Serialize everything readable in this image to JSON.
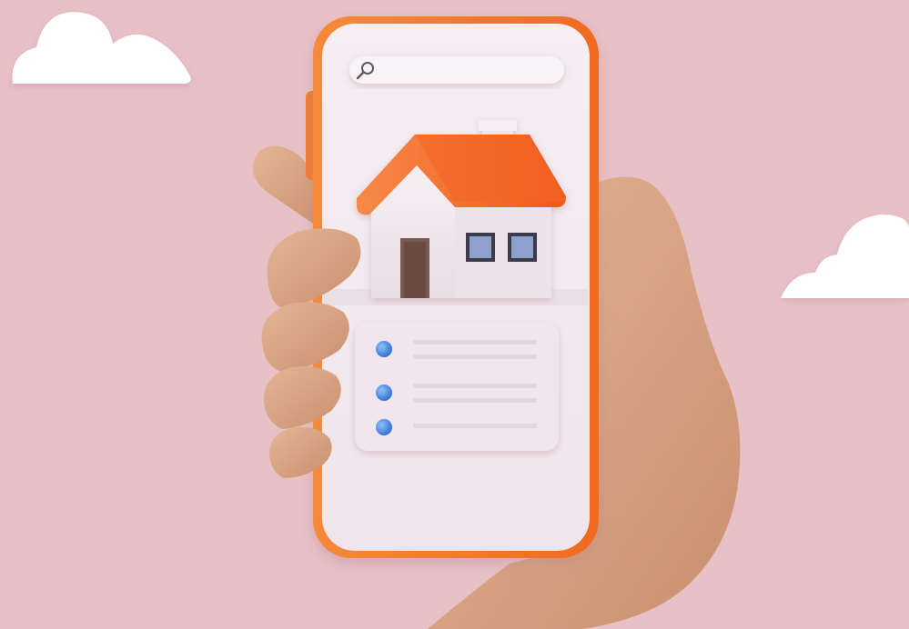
{
  "scene": {
    "subject": "hand-holding-smartphone-with-real-estate-listing",
    "colors": {
      "background": "#e8c1c6",
      "phone_frame": "#f47a2b",
      "phone_screen": "#f1e8ed",
      "roof": "#f4692a",
      "house_wall": "#f4ecf1",
      "door": "#7a5a50",
      "window_glass": "#8ea0ce",
      "bullet": "#3e7fd6",
      "skin": "#d8a888",
      "cloud": "#ffffff"
    },
    "icons": {
      "search": "search-icon",
      "house": "house-icon",
      "list_bullet": "dot-icon",
      "cloud": "cloud-icon"
    },
    "search_bar": {
      "value": "",
      "placeholder": ""
    },
    "list": {
      "item_count": 3
    }
  }
}
